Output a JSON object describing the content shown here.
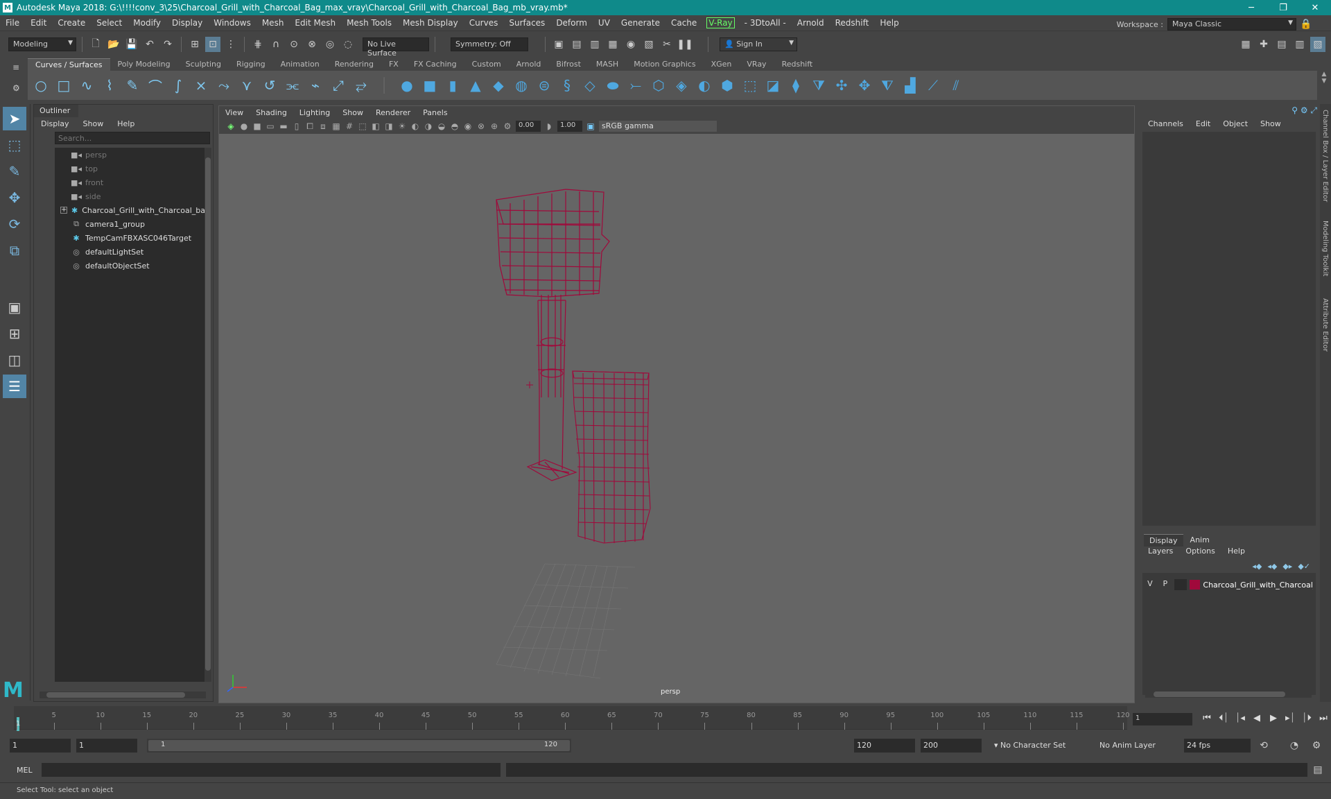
{
  "window": {
    "title": "Autodesk Maya 2018: G:\\!!!!conv_3\\25\\Charcoal_Grill_with_Charcoal_Bag_max_vray\\Charcoal_Grill_with_Charcoal_Bag_mb_vray.mb*",
    "minimize": "─",
    "maximize": "❐",
    "close": "✕"
  },
  "menubar": {
    "items": [
      "File",
      "Edit",
      "Create",
      "Select",
      "Modify",
      "Display",
      "Windows",
      "Mesh",
      "Edit Mesh",
      "Mesh Tools",
      "Mesh Display",
      "Curves",
      "Surfaces",
      "Deform",
      "UV",
      "Generate",
      "Cache"
    ],
    "vray": "V-Ray",
    "items2": [
      "- 3DtoAll -",
      "Arnold",
      "Redshift",
      "Help"
    ],
    "workspace_label": "Workspace :",
    "workspace_value": "Maya Classic"
  },
  "statusline": {
    "mode": "Modeling",
    "live_surface": "No Live Surface",
    "symmetry": "Symmetry: Off",
    "sign_in": "Sign In"
  },
  "shelf": {
    "tabs": [
      "Curves / Surfaces",
      "Poly Modeling",
      "Sculpting",
      "Rigging",
      "Animation",
      "Rendering",
      "FX",
      "FX Caching",
      "Custom",
      "Arnold",
      "Bifrost",
      "MASH",
      "Motion Graphics",
      "XGen",
      "VRay",
      "Redshift"
    ],
    "active_tab": "Curves / Surfaces"
  },
  "outliner": {
    "title": "Outliner",
    "menu": [
      "Display",
      "Show",
      "Help"
    ],
    "search_placeholder": "Search...",
    "items": [
      {
        "label": "persp",
        "icon": "camera-icon",
        "dim": true
      },
      {
        "label": "top",
        "icon": "camera-icon",
        "dim": true
      },
      {
        "label": "front",
        "icon": "camera-icon",
        "dim": true
      },
      {
        "label": "side",
        "icon": "camera-icon",
        "dim": true
      },
      {
        "label": "Charcoal_Grill_with_Charcoal_bag_nc",
        "icon": "transform-icon",
        "dim": false,
        "expandable": true
      },
      {
        "label": "camera1_group",
        "icon": "group-icon",
        "dim": false
      },
      {
        "label": "TempCamFBXASC046Target",
        "icon": "transform-icon",
        "dim": false
      },
      {
        "label": "defaultLightSet",
        "icon": "set-icon",
        "dim": false
      },
      {
        "label": "defaultObjectSet",
        "icon": "set-icon",
        "dim": false
      }
    ]
  },
  "viewport": {
    "menu": [
      "View",
      "Shading",
      "Lighting",
      "Show",
      "Renderer",
      "Panels"
    ],
    "exposure": "0.00",
    "gamma": "1.00",
    "colorspace": "sRGB gamma",
    "camera_label": "persp",
    "wire_color": "#a0093b"
  },
  "channelbox": {
    "menu": [
      "Channels",
      "Edit",
      "Object",
      "Show"
    ],
    "layer_tabs": [
      "Display",
      "Anim"
    ],
    "layer_menu": [
      "Layers",
      "Options",
      "Help"
    ],
    "layer": {
      "v": "V",
      "p": "P",
      "name": "Charcoal_Grill_with_Charcoal_",
      "color": "#a0093b"
    },
    "side_tabs": [
      "Channel Box / Layer Editor",
      "Modeling Toolkit",
      "Attribute Editor"
    ]
  },
  "timeline": {
    "ticks": [
      "1",
      "5",
      "10",
      "15",
      "20",
      "25",
      "30",
      "35",
      "40",
      "45",
      "50",
      "55",
      "60",
      "65",
      "70",
      "75",
      "80",
      "85",
      "90",
      "95",
      "100",
      "105",
      "110",
      "115",
      "120"
    ],
    "current_frame": "1"
  },
  "range": {
    "start": "1",
    "playback_start": "1",
    "range_left": "1",
    "range_right": "120",
    "playback_end": "120",
    "end": "200",
    "character_set": "No Character Set",
    "anim_layer": "No Anim Layer",
    "fps": "24 fps"
  },
  "command": {
    "label": "MEL"
  },
  "help": {
    "text": "Select Tool: select an object"
  }
}
